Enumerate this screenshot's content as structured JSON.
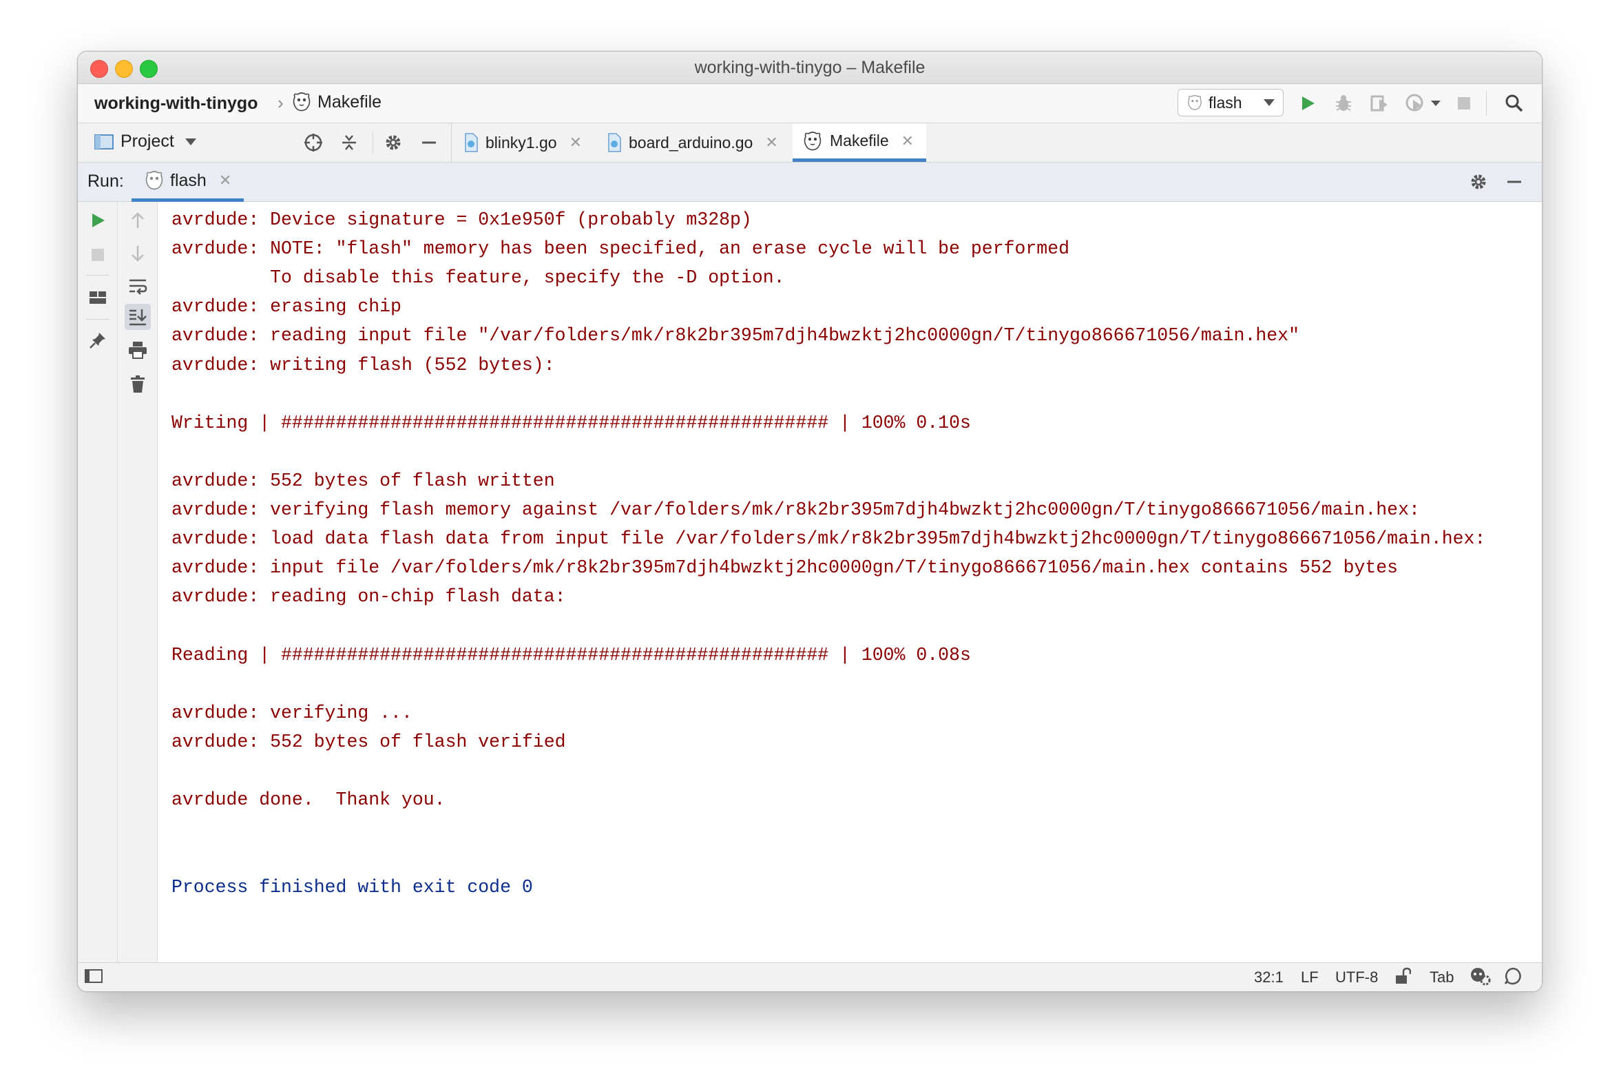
{
  "window": {
    "title": "working-with-tinygo – Makefile"
  },
  "navbar": {
    "project": "working-with-tinygo",
    "file": "Makefile",
    "run_config": "flash",
    "icons": [
      "run-icon",
      "debug-icon",
      "coverage-icon",
      "profile-icon",
      "stop-icon",
      "search-icon"
    ]
  },
  "project_pane": {
    "label": "Project"
  },
  "tabs": [
    {
      "label": "blinky1.go",
      "icon": "go-file-icon"
    },
    {
      "label": "board_arduino.go",
      "icon": "go-file-icon"
    },
    {
      "label": "Makefile",
      "icon": "makefile-icon",
      "active": true
    }
  ],
  "run": {
    "label": "Run:",
    "tab": "flash"
  },
  "console": {
    "lines": [
      "avrdude: Device signature = 0x1e950f (probably m328p)",
      "avrdude: NOTE: \"flash\" memory has been specified, an erase cycle will be performed",
      "         To disable this feature, specify the -D option.",
      "avrdude: erasing chip",
      "avrdude: reading input file \"/var/folders/mk/r8k2br395m7djh4bwzktj2hc0000gn/T/tinygo866671056/main.hex\"",
      "avrdude: writing flash (552 bytes):",
      "",
      "Writing | ################################################## | 100% 0.10s",
      "",
      "avrdude: 552 bytes of flash written",
      "avrdude: verifying flash memory against /var/folders/mk/r8k2br395m7djh4bwzktj2hc0000gn/T/tinygo866671056/main.hex:",
      "avrdude: load data flash data from input file /var/folders/mk/r8k2br395m7djh4bwzktj2hc0000gn/T/tinygo866671056/main.hex:",
      "avrdude: input file /var/folders/mk/r8k2br395m7djh4bwzktj2hc0000gn/T/tinygo866671056/main.hex contains 552 bytes",
      "avrdude: reading on-chip flash data:",
      "",
      "Reading | ################################################## | 100% 0.08s",
      "",
      "avrdude: verifying ...",
      "avrdude: 552 bytes of flash verified",
      "",
      "avrdude done.  Thank you.",
      "",
      ""
    ],
    "exit_line": "Process finished with exit code 0",
    "output_color": "#8b0000",
    "exit_color": "#0b2d8b"
  },
  "status": {
    "position": "32:1",
    "line_separator": "LF",
    "encoding": "UTF-8",
    "indent": "Tab"
  }
}
